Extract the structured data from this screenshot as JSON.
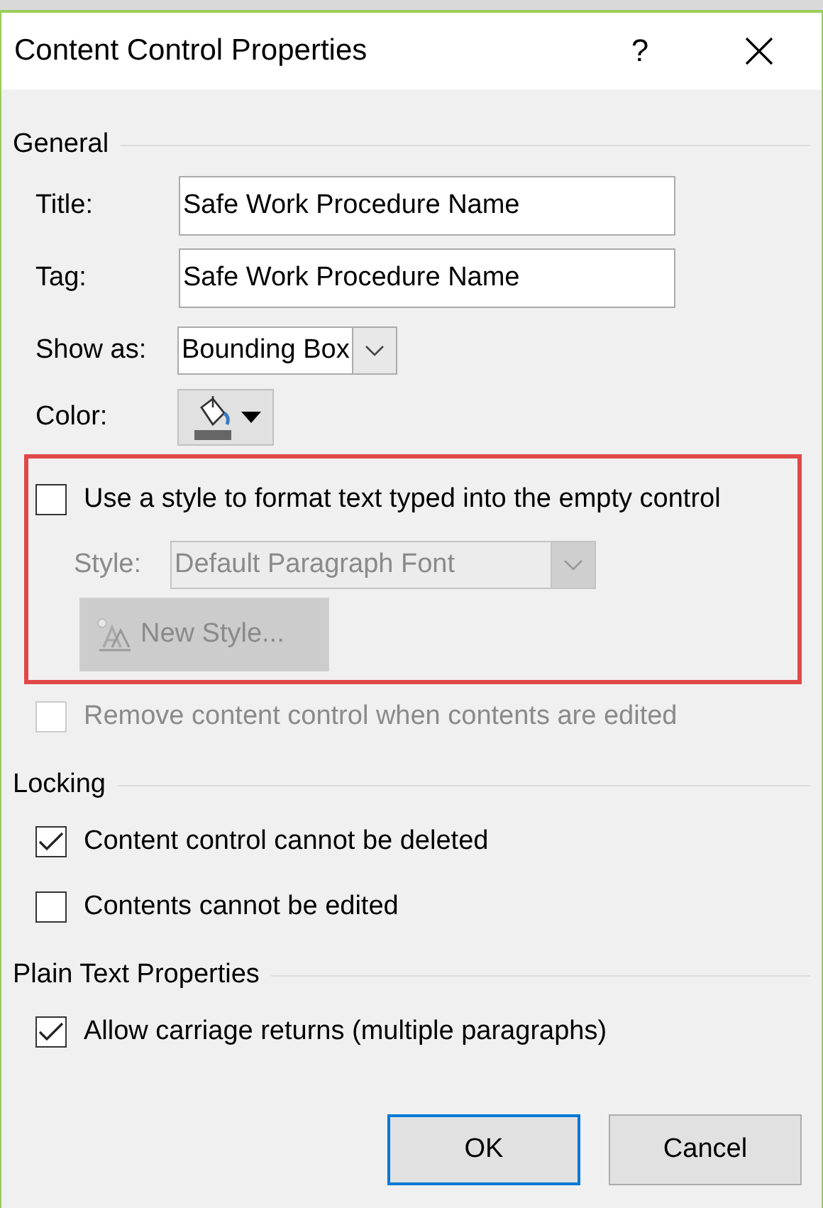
{
  "window": {
    "title": "Content Control Properties",
    "help": "?"
  },
  "general": {
    "heading": "General",
    "fields": [
      {
        "label": "Title:",
        "value": "Safe Work Procedure Name"
      },
      {
        "label": "Tag:",
        "value": "Safe Work Procedure Name"
      }
    ],
    "show_as": {
      "label": "Show as:",
      "value": "Bounding Box"
    },
    "color": {
      "label": "Color:"
    },
    "style_group": {
      "highlighted": true,
      "checkbox": {
        "label": "Use a style to format text typed into the empty control",
        "checked": false,
        "disabled": false
      },
      "style": {
        "label": "Style:",
        "value": "Default Paragraph Font",
        "disabled": true
      },
      "new_style": {
        "label": "New Style...",
        "disabled": true
      }
    },
    "remove": {
      "label": "Remove content control when contents are edited",
      "checked": false,
      "disabled": true
    }
  },
  "locking": {
    "heading": "Locking",
    "options": [
      {
        "label": "Content control cannot be deleted",
        "checked": true,
        "disabled": false
      },
      {
        "label": "Contents cannot be edited",
        "checked": false,
        "disabled": false
      }
    ]
  },
  "plain_text": {
    "heading": "Plain Text Properties",
    "options": [
      {
        "label": "Allow carriage returns (multiple paragraphs)",
        "checked": true,
        "disabled": false
      }
    ]
  },
  "buttons": [
    {
      "label": "OK",
      "default": true
    },
    {
      "label": "Cancel",
      "default": false
    }
  ]
}
